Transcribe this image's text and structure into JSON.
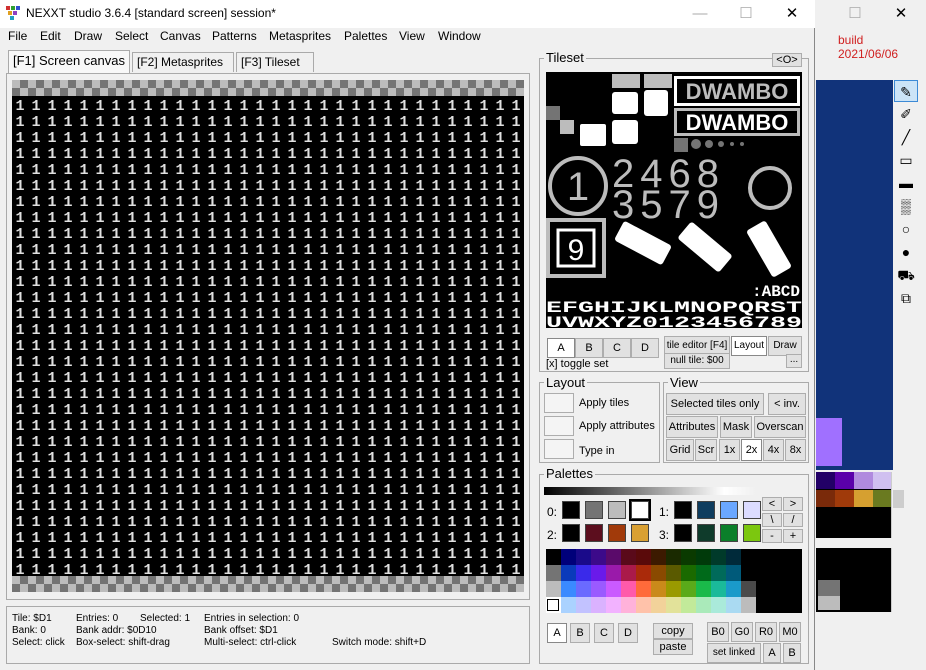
{
  "window": {
    "title": "NEXXT studio 3.6.4  [standard screen] session*",
    "minimize": "—",
    "maximize": "☐",
    "close": "✕"
  },
  "menu": [
    "File",
    "Edit",
    "Draw",
    "Select",
    "Canvas",
    "Patterns",
    "Metasprites",
    "Palettes",
    "View",
    "Window"
  ],
  "tabs": [
    "[F1] Screen canvas",
    "[F2] Metasprites",
    "[F3] Tileset"
  ],
  "canvas": {
    "tile_char": "1",
    "cols": 32,
    "rows": 30
  },
  "status": {
    "tile": "Tile: $D1",
    "entries": "Entries: 0",
    "selected": "Selected: 1",
    "entries_sel": "Entries in selection: 0",
    "bank": "Bank: 0",
    "bank_addr": "Bank addr: $0D10",
    "bank_offset": "Bank offset: $D1",
    "select_click": "Select: click",
    "box_select": "Box-select: shift-drag",
    "multi_select": "Multi-select: ctrl-click",
    "switch_mode": "Switch mode: shift+D"
  },
  "tileset": {
    "title": "Tileset",
    "toggle_btn": "<O>",
    "big_text_1": "DWAMBO",
    "big_text_2": "DWAMBO",
    "digits_top": "2468",
    "digits_bottom": "3579",
    "circle_digit": "1",
    "box_digit": "9",
    "row_alpha_1": ":ABCD",
    "row_alpha_2": "EFGHIJKLMNOPQRST",
    "row_alpha_3": "UVWXYZ0123456789",
    "set_buttons": [
      "A",
      "B",
      "C",
      "D"
    ],
    "tile_editor": "tile editor [F4]",
    "layout_btn": "Layout",
    "draw_btn": "Draw",
    "null_tile": "null tile: $00",
    "more_btn": "...",
    "toggle_set": "[x] toggle set"
  },
  "layout": {
    "title": "Layout",
    "apply_tiles": "Apply tiles",
    "apply_attributes": "Apply attributes",
    "type_in": "Type in"
  },
  "view": {
    "title": "View",
    "selected_tiles_only": "Selected tiles only",
    "inv": "< inv.",
    "attributes": "Attributes",
    "mask": "Mask",
    "overscan": "Overscan",
    "grid": "Grid",
    "scr": "Scr",
    "zoom": [
      "1x",
      "2x",
      "4x",
      "8x"
    ],
    "zoom_selected": "2x"
  },
  "palettes": {
    "title": "Palettes",
    "labels": [
      "0:",
      "1:",
      "2:",
      "3:"
    ],
    "sub": [
      [
        "#000000",
        "#747474",
        "#bcbcbc",
        "#ffffff"
      ],
      [
        "#000000",
        "#0f3d5f",
        "#6aa7ff",
        "#dcdcff"
      ],
      [
        "#000000",
        "#5c0e1e",
        "#a13a0a",
        "#d9a033"
      ],
      [
        "#000000",
        "#0f3b2b",
        "#0b7f2a",
        "#7cc70f"
      ]
    ],
    "shift_up": "<",
    "shift_right": ">",
    "shift_a": "\\",
    "shift_b": "/",
    "minus": "-",
    "plus": "+",
    "set_buttons": [
      "A",
      "B",
      "C",
      "D"
    ],
    "copy": "copy",
    "paste": "paste",
    "bank_buttons": [
      "B0",
      "G0",
      "R0",
      "M0"
    ],
    "set_linked": "set linked",
    "link_a": "A",
    "link_b": "B",
    "nes_rows": [
      [
        "#000000",
        "#00007a",
        "#1a0a8a",
        "#3c0a8a",
        "#5a0a6a",
        "#5a0a1a",
        "#5a0a0a",
        "#3c1a00",
        "#1a2a00",
        "#0a3a00",
        "#003a0a",
        "#003a2a",
        "#002a3a",
        "#000000"
      ],
      [
        "#747474",
        "#0a3aba",
        "#3a2aea",
        "#6a1aea",
        "#9a1aaa",
        "#aa1a4a",
        "#aa2a0a",
        "#8a4a00",
        "#5a5a00",
        "#1a6a00",
        "#006a1a",
        "#006a5a",
        "#005a7a",
        "#000000"
      ],
      [
        "#bcbcbc",
        "#3a8aff",
        "#6a6aff",
        "#9a5aff",
        "#ca5aff",
        "#ff5aaa",
        "#ff6a3a",
        "#ca8a1a",
        "#9a9a00",
        "#5aaa1a",
        "#1aba4a",
        "#1aba9a",
        "#1a9aca",
        "#4a4a4a"
      ],
      [
        "#ffffff",
        "#aad2ff",
        "#c2c2ff",
        "#dab2ff",
        "#f2b2ff",
        "#ffb2da",
        "#ffc2aa",
        "#f2d29a",
        "#e2e29a",
        "#c2ea9a",
        "#aaeaba",
        "#aaeada",
        "#aadaf2",
        "#bcbcbc"
      ]
    ]
  },
  "side": {
    "build": "build 2021/06/06",
    "maximize": "☐",
    "close": "✕",
    "tools": [
      "pen-icon",
      "pencil-icon",
      "line-icon",
      "rect-outline-icon",
      "rect-filled-icon",
      "dither-icon",
      "circle-outline-icon",
      "circle-filled-icon",
      "fill-bucket-icon",
      "clone-icon"
    ],
    "tool_glyphs": [
      "✎",
      "✐",
      "╱",
      "▭",
      "▬",
      "▒",
      "○",
      "●",
      "⛟",
      "⧉"
    ],
    "swatch_row_1": [
      "#220066",
      "#5a00aa",
      "#b08ade",
      "#d0c0f0"
    ],
    "swatch_row_2": [
      "#7a2a0a",
      "#a03a0a",
      "#d6a030",
      "#6a7a20"
    ]
  }
}
